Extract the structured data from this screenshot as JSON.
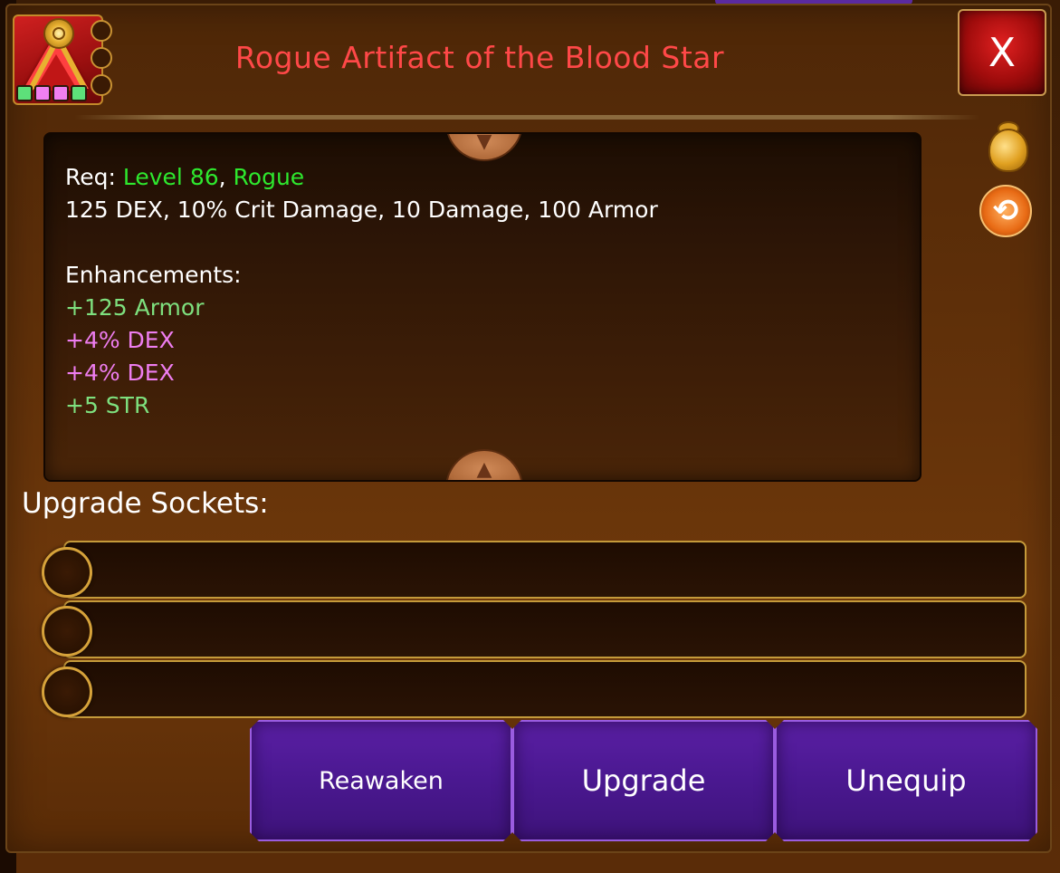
{
  "item": {
    "title": "Rogue Artifact of the Blood Star",
    "title_color": "#ff4848",
    "icon": "blood-star-artifact-icon",
    "gem_slots": [
      "green",
      "pink",
      "pink",
      "green"
    ]
  },
  "close_label": "X",
  "side_icons": [
    "coin-bag-icon",
    "swap-icon"
  ],
  "details": {
    "req_label": "Req:",
    "req_level": "Level 86",
    "req_sep": ",",
    "req_class": "Rogue",
    "stats": "125 DEX, 10% Crit Damage, 10 Damage, 100 Armor",
    "enhancements_title": "Enhancements:",
    "enhancements": [
      {
        "text": "+125 Armor",
        "color": "#7ee07e"
      },
      {
        "text": "+4% DEX",
        "color": "#ee7df0"
      },
      {
        "text": "+4% DEX",
        "color": "#ee7df0"
      },
      {
        "text": "+5 STR",
        "color": "#7ee07e"
      }
    ]
  },
  "upgrade_sockets": {
    "title": "Upgrade Sockets:",
    "count": 3
  },
  "buttons": {
    "reawaken": "Reawaken",
    "upgrade": "Upgrade",
    "unequip": "Unequip"
  }
}
